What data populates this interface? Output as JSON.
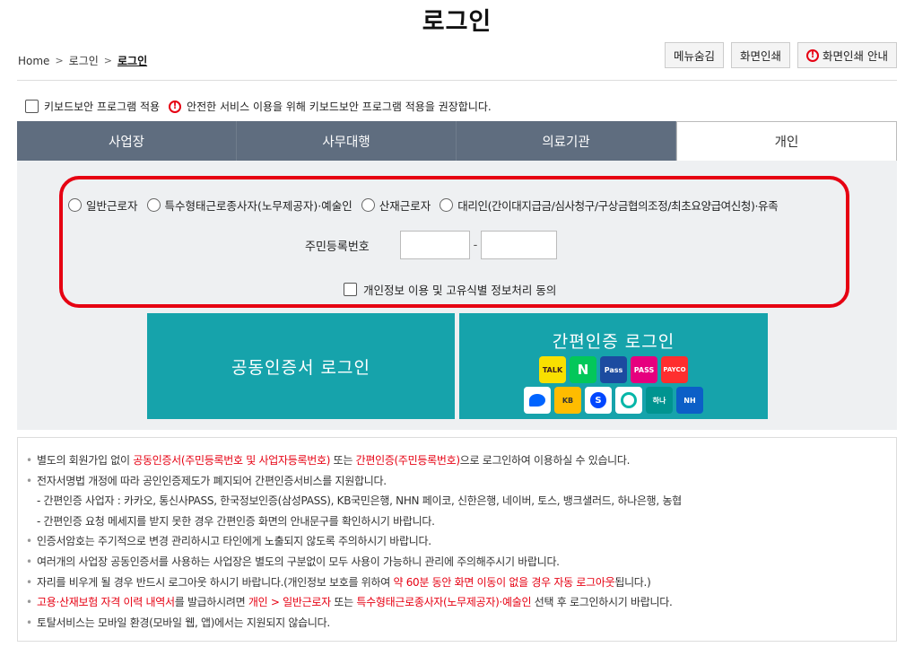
{
  "page": {
    "title": "로그인"
  },
  "breadcrumb": {
    "home": "Home",
    "level1": "로그인",
    "current": "로그인"
  },
  "toolbar": {
    "menu_hide": "메뉴숨김",
    "print": "화면인쇄",
    "print_guide": "화면인쇄 안내"
  },
  "keyboard": {
    "label": "키보드보안 프로그램 적용",
    "notice": "안전한 서비스 이용을 위해 키보드보안 프로그램 적용을 권장합니다."
  },
  "tabs": [
    {
      "label": "사업장"
    },
    {
      "label": "사무대행"
    },
    {
      "label": "의료기관"
    },
    {
      "label": "개인"
    }
  ],
  "radios": [
    {
      "label": "일반근로자"
    },
    {
      "label": "특수형태근로종사자(노무제공자)·예술인"
    },
    {
      "label": "산재근로자"
    },
    {
      "label": "대리인(간이대지급금/심사청구/구상금협의조정/최초요양급여신청)·유족"
    }
  ],
  "id_field": {
    "label": "주민등록번호",
    "dash": "-"
  },
  "agree": {
    "label": "개인정보 이용 및 고유식별 정보처리 동의"
  },
  "buttons": {
    "cert_login": "공동인증서 로그인",
    "simple_login": "간편인증 로그인"
  },
  "auth_icons": [
    {
      "name": "kakao-icon",
      "text": "TALK",
      "color": "#f9e000"
    },
    {
      "name": "naver-icon",
      "text": "N",
      "color": "#03c75a"
    },
    {
      "name": "samsung-pass-icon",
      "text": "Pass",
      "color": "#1c4ba0"
    },
    {
      "name": "pass-icon",
      "text": "PASS",
      "color": "#e6007e"
    },
    {
      "name": "payco-icon",
      "text": "PAYCO",
      "color": "#ff2e2e"
    },
    {
      "name": "toss-icon",
      "text": "",
      "color": "#0064ff"
    },
    {
      "name": "kb-icon",
      "text": "KB",
      "color": "#ffbc00"
    },
    {
      "name": "shinhan-icon",
      "text": "S",
      "color": "#0046ff"
    },
    {
      "name": "banksalad-icon",
      "text": "",
      "color": "#05b6a8"
    },
    {
      "name": "hana-icon",
      "text": "하나",
      "color": "#009490"
    },
    {
      "name": "nh-icon",
      "text": "NH",
      "color": "#0c5fc7"
    }
  ],
  "notice": {
    "l1_a": "별도의 회원가입 없이 ",
    "l1_b": "공동인증서(주민등록번호 및 사업자등록번호)",
    "l1_c": " 또는 ",
    "l1_d": "간편인증(주민등록번호)",
    "l1_e": "으로 로그인하여 이용하실 수 있습니다.",
    "l2": "전자서명법 개정에 따라 공인인증제도가 폐지되어 간편인증서비스를 지원합니다.",
    "l3": "- 간편인증 사업자 : 카카오, 통신사PASS, 한국정보인증(삼성PASS), KB국민은행, NHN 페이코, 신한은행, 네이버, 토스, 뱅크샐러드, 하나은행, 농협",
    "l4": "- 간편인증 요청 메세지를 받지 못한 경우 간편인증 화면의 안내문구를 확인하시기 바랍니다.",
    "l5": "인증서암호는 주기적으로 변경 관리하시고 타인에게 노출되지 않도록 주의하시기 바랍니다.",
    "l6": "여러개의 사업장 공동인증서를 사용하는 사업장은 별도의 구분없이 모두 사용이 가능하니 관리에 주의해주시기 바랍니다.",
    "l7_a": "자리를 비우게 될 경우 반드시 로그아웃 하시기 바랍니다.(개인정보 보호를 위하여 ",
    "l7_b": "약 60분 동안 화면 이동이 없을 경우 자동 로그아웃",
    "l7_c": "됩니다.)",
    "l8_a": "고용·산재보험 자격 이력 내역서",
    "l8_b": "를 발급하시려면 ",
    "l8_c": "개인 > 일반근로자",
    "l8_d": " 또는 ",
    "l8_e": "특수형태근로종사자(노무제공자)·예술인",
    "l8_f": " 선택 후 로그인하시기 바랍니다.",
    "l9": "토탈서비스는 모바일 환경(모바일 웹, 앱)에서는 지원되지 않습니다."
  },
  "colors": {
    "tab_bg": "#5f6d7f",
    "button_bg": "#16a3ab",
    "highlight": "#e60012"
  }
}
